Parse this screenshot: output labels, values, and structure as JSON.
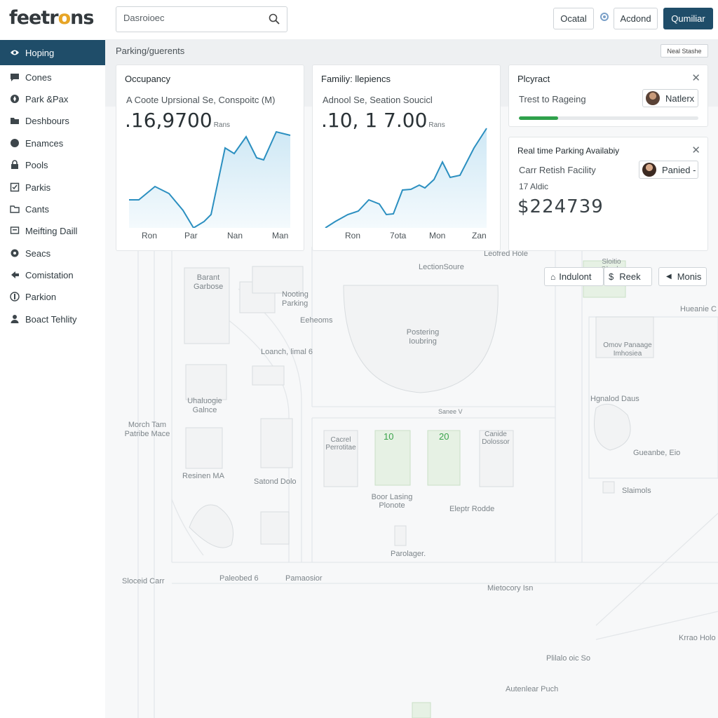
{
  "app": {
    "logo_main": "feetr",
    "logo_accent": "o",
    "logo_tail": "ns"
  },
  "search": {
    "placeholder": "Dasroioec"
  },
  "topbar": {
    "btn1": "Ocatal",
    "btn2": "Acdond",
    "btn3": "Qumiliar"
  },
  "sidebar": {
    "items": [
      {
        "label": "Hoping",
        "icon": "eye-icon"
      },
      {
        "label": "Cones",
        "icon": "chat-icon"
      },
      {
        "label": "Park &Pax",
        "icon": "compass-icon"
      },
      {
        "label": "Deshbours",
        "icon": "folder-icon"
      },
      {
        "label": "Enamces",
        "icon": "circle-icon"
      },
      {
        "label": "Pools",
        "icon": "lock-icon"
      },
      {
        "label": "Parkis",
        "icon": "checkbox-icon"
      },
      {
        "label": "Cants",
        "icon": "folder-icon"
      },
      {
        "label": "Meifting Daill",
        "icon": "screen-icon"
      },
      {
        "label": "Seacs",
        "icon": "gear-icon"
      },
      {
        "label": "Comistation",
        "icon": "share-icon"
      },
      {
        "label": "Parkion",
        "icon": "parking-icon"
      },
      {
        "label": "Boact Tehlity",
        "icon": "user-icon"
      }
    ]
  },
  "header": {
    "title": "Parking/guerents",
    "button": "Neal Stashe"
  },
  "cards": {
    "occupancy": {
      "title": "Occupancy",
      "subtitle": "A Coote Uprsional Se, Conspoitc (M)",
      "value": ".16,9700",
      "unit": "Rans",
      "xlabels": [
        "Ron",
        "Par",
        "Nan",
        "Man"
      ]
    },
    "familiy": {
      "title": "Familiy: llepiencs",
      "subtitle": "Adnool Se, Seation Soucicl",
      "value": ".10, 1 7.00",
      "unit": "Rans",
      "xlabels": [
        "Ron",
        "7ota",
        "Mon",
        "Zan"
      ]
    },
    "playract": {
      "title": "Plcyract",
      "subtitle": "Trest to Rageing",
      "chip": "Natlerx",
      "progress": 0.22
    },
    "realtime": {
      "title": "Real time Parking Availabiy",
      "subtitle": "Carr Retish Facility",
      "detail": "17 Aldic",
      "chip": "Panied -",
      "price": "$224739"
    }
  },
  "filters": {
    "f1": "Indulont",
    "f2": "Reek",
    "f3": "Monis"
  },
  "map": {
    "labels": [
      "LectionSoure",
      "Leofred Hole",
      "Barant Garbose",
      "Nooting Parking",
      "Eeheoms",
      "Postering Ioubring",
      "Loanch, limal 6",
      "Uhaluogie Galnce",
      "Morch Tam Patribe Mace",
      "Resinen MA",
      "Satond Dolo",
      "Hgnalod Daus",
      "Omov Panaage Imhosiea",
      "Gueanbe, Eio",
      "Slaimols",
      "Cacrel Perrotitae",
      "Boor Lasing Plonote",
      "Eleptr Rodde",
      "Parolager.",
      "Sloceid Carr",
      "Paleobed 6",
      "Pamaosior",
      "Mietocory Isn",
      "Krrao Holo",
      "Plilalo oic So",
      "Autenlear Puch",
      "Hueanie C",
      "Canide Dolossor",
      "Sanee V",
      "Sloitio Ohrolo"
    ],
    "lot_a": "10",
    "lot_b": "20"
  }
}
